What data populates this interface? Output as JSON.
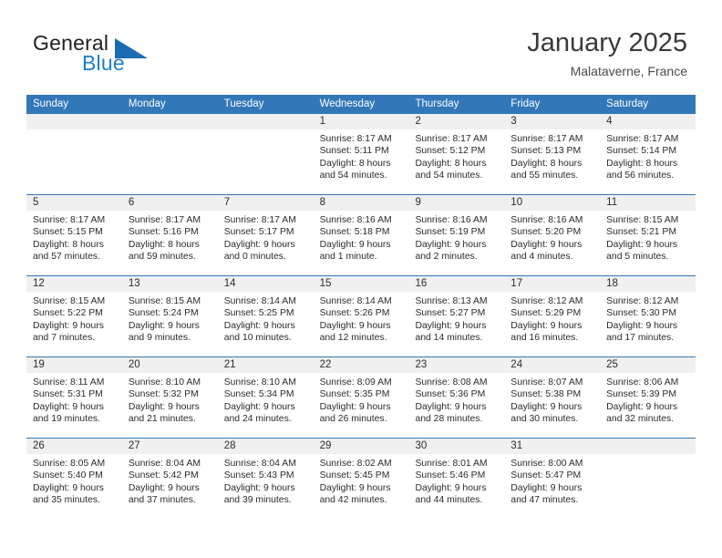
{
  "brand": {
    "name_top": "General",
    "name_bottom": "Blue",
    "triangle_color": "#1b6cb0",
    "blue_text_color": "#1f7ec4"
  },
  "header": {
    "title": "January 2025",
    "subtitle": "Malataverne, France"
  },
  "theme": {
    "header_blue": "#3277b8",
    "day_number_band": "#f0f0f0",
    "text": "#2b2b2b"
  },
  "day_names": [
    "Sunday",
    "Monday",
    "Tuesday",
    "Wednesday",
    "Thursday",
    "Friday",
    "Saturday"
  ],
  "weeks": [
    [
      {
        "day": "",
        "empty": true,
        "lines": []
      },
      {
        "day": "",
        "empty": true,
        "lines": []
      },
      {
        "day": "",
        "empty": true,
        "lines": []
      },
      {
        "day": "1",
        "lines": [
          "Sunrise: 8:17 AM",
          "Sunset: 5:11 PM",
          "Daylight: 8 hours",
          "and 54 minutes."
        ]
      },
      {
        "day": "2",
        "lines": [
          "Sunrise: 8:17 AM",
          "Sunset: 5:12 PM",
          "Daylight: 8 hours",
          "and 54 minutes."
        ]
      },
      {
        "day": "3",
        "lines": [
          "Sunrise: 8:17 AM",
          "Sunset: 5:13 PM",
          "Daylight: 8 hours",
          "and 55 minutes."
        ]
      },
      {
        "day": "4",
        "lines": [
          "Sunrise: 8:17 AM",
          "Sunset: 5:14 PM",
          "Daylight: 8 hours",
          "and 56 minutes."
        ]
      }
    ],
    [
      {
        "day": "5",
        "lines": [
          "Sunrise: 8:17 AM",
          "Sunset: 5:15 PM",
          "Daylight: 8 hours",
          "and 57 minutes."
        ]
      },
      {
        "day": "6",
        "lines": [
          "Sunrise: 8:17 AM",
          "Sunset: 5:16 PM",
          "Daylight: 8 hours",
          "and 59 minutes."
        ]
      },
      {
        "day": "7",
        "lines": [
          "Sunrise: 8:17 AM",
          "Sunset: 5:17 PM",
          "Daylight: 9 hours",
          "and 0 minutes."
        ]
      },
      {
        "day": "8",
        "lines": [
          "Sunrise: 8:16 AM",
          "Sunset: 5:18 PM",
          "Daylight: 9 hours",
          "and 1 minute."
        ]
      },
      {
        "day": "9",
        "lines": [
          "Sunrise: 8:16 AM",
          "Sunset: 5:19 PM",
          "Daylight: 9 hours",
          "and 2 minutes."
        ]
      },
      {
        "day": "10",
        "lines": [
          "Sunrise: 8:16 AM",
          "Sunset: 5:20 PM",
          "Daylight: 9 hours",
          "and 4 minutes."
        ]
      },
      {
        "day": "11",
        "lines": [
          "Sunrise: 8:15 AM",
          "Sunset: 5:21 PM",
          "Daylight: 9 hours",
          "and 5 minutes."
        ]
      }
    ],
    [
      {
        "day": "12",
        "lines": [
          "Sunrise: 8:15 AM",
          "Sunset: 5:22 PM",
          "Daylight: 9 hours",
          "and 7 minutes."
        ]
      },
      {
        "day": "13",
        "lines": [
          "Sunrise: 8:15 AM",
          "Sunset: 5:24 PM",
          "Daylight: 9 hours",
          "and 9 minutes."
        ]
      },
      {
        "day": "14",
        "lines": [
          "Sunrise: 8:14 AM",
          "Sunset: 5:25 PM",
          "Daylight: 9 hours",
          "and 10 minutes."
        ]
      },
      {
        "day": "15",
        "lines": [
          "Sunrise: 8:14 AM",
          "Sunset: 5:26 PM",
          "Daylight: 9 hours",
          "and 12 minutes."
        ]
      },
      {
        "day": "16",
        "lines": [
          "Sunrise: 8:13 AM",
          "Sunset: 5:27 PM",
          "Daylight: 9 hours",
          "and 14 minutes."
        ]
      },
      {
        "day": "17",
        "lines": [
          "Sunrise: 8:12 AM",
          "Sunset: 5:29 PM",
          "Daylight: 9 hours",
          "and 16 minutes."
        ]
      },
      {
        "day": "18",
        "lines": [
          "Sunrise: 8:12 AM",
          "Sunset: 5:30 PM",
          "Daylight: 9 hours",
          "and 17 minutes."
        ]
      }
    ],
    [
      {
        "day": "19",
        "lines": [
          "Sunrise: 8:11 AM",
          "Sunset: 5:31 PM",
          "Daylight: 9 hours",
          "and 19 minutes."
        ]
      },
      {
        "day": "20",
        "lines": [
          "Sunrise: 8:10 AM",
          "Sunset: 5:32 PM",
          "Daylight: 9 hours",
          "and 21 minutes."
        ]
      },
      {
        "day": "21",
        "lines": [
          "Sunrise: 8:10 AM",
          "Sunset: 5:34 PM",
          "Daylight: 9 hours",
          "and 24 minutes."
        ]
      },
      {
        "day": "22",
        "lines": [
          "Sunrise: 8:09 AM",
          "Sunset: 5:35 PM",
          "Daylight: 9 hours",
          "and 26 minutes."
        ]
      },
      {
        "day": "23",
        "lines": [
          "Sunrise: 8:08 AM",
          "Sunset: 5:36 PM",
          "Daylight: 9 hours",
          "and 28 minutes."
        ]
      },
      {
        "day": "24",
        "lines": [
          "Sunrise: 8:07 AM",
          "Sunset: 5:38 PM",
          "Daylight: 9 hours",
          "and 30 minutes."
        ]
      },
      {
        "day": "25",
        "lines": [
          "Sunrise: 8:06 AM",
          "Sunset: 5:39 PM",
          "Daylight: 9 hours",
          "and 32 minutes."
        ]
      }
    ],
    [
      {
        "day": "26",
        "lines": [
          "Sunrise: 8:05 AM",
          "Sunset: 5:40 PM",
          "Daylight: 9 hours",
          "and 35 minutes."
        ]
      },
      {
        "day": "27",
        "lines": [
          "Sunrise: 8:04 AM",
          "Sunset: 5:42 PM",
          "Daylight: 9 hours",
          "and 37 minutes."
        ]
      },
      {
        "day": "28",
        "lines": [
          "Sunrise: 8:04 AM",
          "Sunset: 5:43 PM",
          "Daylight: 9 hours",
          "and 39 minutes."
        ]
      },
      {
        "day": "29",
        "lines": [
          "Sunrise: 8:02 AM",
          "Sunset: 5:45 PM",
          "Daylight: 9 hours",
          "and 42 minutes."
        ]
      },
      {
        "day": "30",
        "lines": [
          "Sunrise: 8:01 AM",
          "Sunset: 5:46 PM",
          "Daylight: 9 hours",
          "and 44 minutes."
        ]
      },
      {
        "day": "31",
        "lines": [
          "Sunrise: 8:00 AM",
          "Sunset: 5:47 PM",
          "Daylight: 9 hours",
          "and 47 minutes."
        ]
      },
      {
        "day": "",
        "empty": true,
        "lines": []
      }
    ]
  ]
}
